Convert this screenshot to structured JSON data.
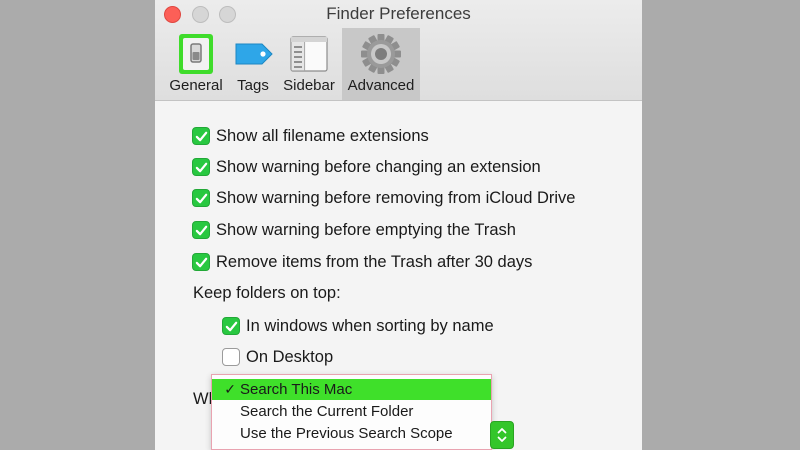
{
  "window": {
    "title": "Finder Preferences"
  },
  "tabs": [
    {
      "label": "General",
      "icon": "general-switch-icon",
      "active": false
    },
    {
      "label": "Tags",
      "icon": "tag-icon",
      "active": false
    },
    {
      "label": "Sidebar",
      "icon": "sidebar-icon",
      "active": false
    },
    {
      "label": "Advanced",
      "icon": "gear-icon",
      "active": true
    }
  ],
  "options": [
    {
      "label": "Show all filename extensions",
      "checked": true
    },
    {
      "label": "Show warning before changing an extension",
      "checked": true
    },
    {
      "label": "Show warning before removing from iCloud Drive",
      "checked": true
    },
    {
      "label": "Show warning before emptying the Trash",
      "checked": true
    },
    {
      "label": "Remove items from the Trash after 30 days",
      "checked": true
    }
  ],
  "keep_folders": {
    "label": "Keep folders on top:",
    "options": [
      {
        "label": "In windows when sorting by name",
        "checked": true
      },
      {
        "label": "On Desktop",
        "checked": false
      }
    ]
  },
  "search_scope": {
    "partial_label": "Wh",
    "menu": [
      {
        "label": "Search This Mac",
        "selected": true,
        "mark": "✓"
      },
      {
        "label": "Search the Current Folder",
        "selected": false,
        "mark": ""
      },
      {
        "label": "Use the Previous Search Scope",
        "selected": false,
        "mark": ""
      }
    ]
  },
  "colors": {
    "accent": "#28c840",
    "menu_highlight": "#3fe02a",
    "close_button": "#fc5f57"
  }
}
